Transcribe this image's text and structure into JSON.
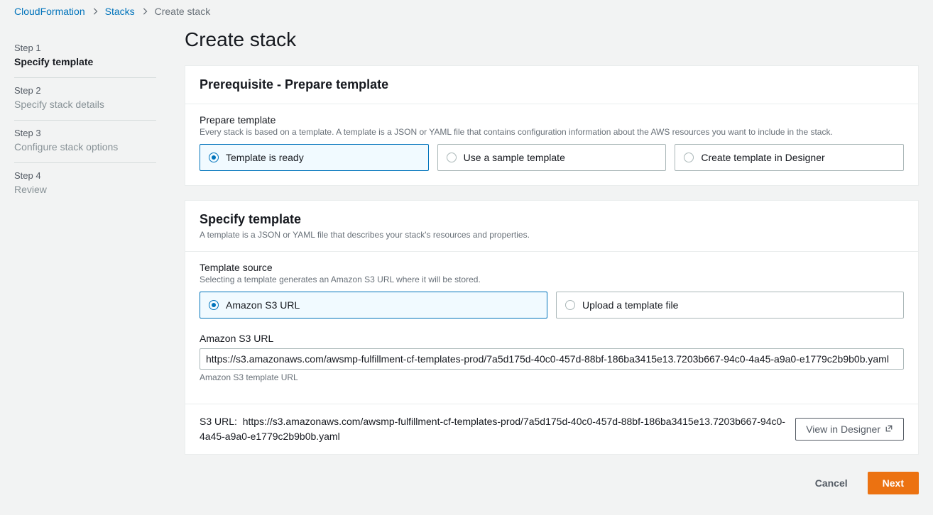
{
  "breadcrumb": {
    "root": "CloudFormation",
    "parent": "Stacks",
    "current": "Create stack"
  },
  "sidebar": {
    "steps": [
      {
        "num": "Step 1",
        "title": "Specify template",
        "active": true
      },
      {
        "num": "Step 2",
        "title": "Specify stack details",
        "active": false
      },
      {
        "num": "Step 3",
        "title": "Configure stack options",
        "active": false
      },
      {
        "num": "Step 4",
        "title": "Review",
        "active": false
      }
    ]
  },
  "page": {
    "title": "Create stack"
  },
  "prereq": {
    "header": "Prerequisite - Prepare template",
    "field_label": "Prepare template",
    "field_help": "Every stack is based on a template. A template is a JSON or YAML file that contains configuration information about the AWS resources you want to include in the stack.",
    "options": {
      "ready": "Template is ready",
      "sample": "Use a sample template",
      "designer": "Create template in Designer"
    }
  },
  "specify": {
    "header": "Specify template",
    "subtitle": "A template is a JSON or YAML file that describes your stack's resources and properties.",
    "source_label": "Template source",
    "source_help": "Selecting a template generates an Amazon S3 URL where it will be stored.",
    "options": {
      "s3": "Amazon S3 URL",
      "upload": "Upload a template file"
    },
    "s3_label": "Amazon S3 URL",
    "s3_value": "https://s3.amazonaws.com/awsmp-fulfillment-cf-templates-prod/7a5d175d-40c0-457d-88bf-186ba3415e13.7203b667-94c0-4a45-a9a0-e1779c2b9b0b.yaml",
    "s3_help": "Amazon S3 template URL",
    "s3_url_prefix": "S3 URL:",
    "s3_url_full": "https://s3.amazonaws.com/awsmp-fulfillment-cf-templates-prod/7a5d175d-40c0-457d-88bf-186ba3415e13.7203b667-94c0-4a45-a9a0-e1779c2b9b0b.yaml",
    "view_designer": "View in Designer"
  },
  "actions": {
    "cancel": "Cancel",
    "next": "Next"
  }
}
